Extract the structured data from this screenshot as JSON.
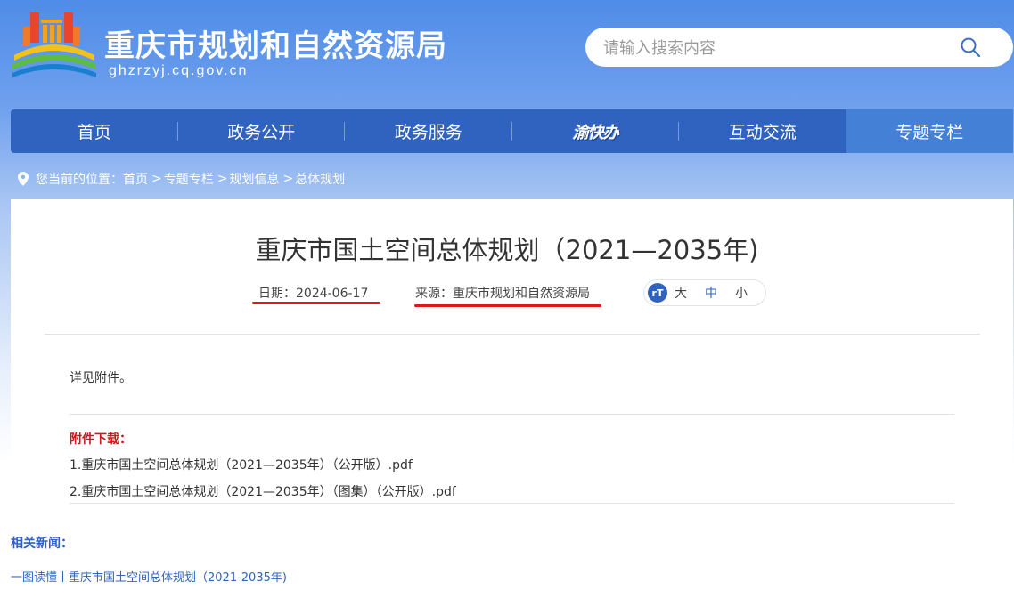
{
  "header": {
    "site_title": "重庆市规划和自然资源局",
    "site_domain": "ghzrzyj.cq.gov.cn",
    "search_placeholder": "请输入搜索内容"
  },
  "nav": {
    "items": [
      {
        "label": "首页"
      },
      {
        "label": "政务公开"
      },
      {
        "label": "政务服务"
      },
      {
        "label": "渝快办"
      },
      {
        "label": "互动交流"
      },
      {
        "label": "专题专栏",
        "active": true
      }
    ]
  },
  "breadcrumb": {
    "prefix": "您当前的位置：",
    "items": [
      "首页",
      "专题专栏",
      "规划信息",
      "总体规划"
    ],
    "separator": ">"
  },
  "article": {
    "title": "重庆市国土空间总体规划（2021—2035年)",
    "date": "日期：2024-06-17",
    "source": "来源：重庆市规划和自然资源局",
    "font_icon": "rT",
    "font_sizes": [
      "大",
      "中",
      "小"
    ],
    "font_size_selected": "中",
    "body": "详见附件。",
    "attachments_label": "附件下载：",
    "attachments": [
      "1.重庆市国土空间总体规划（2021—2035年）（公开版）.pdf",
      "2.重庆市国土空间总体规划（2021—2035年）（图集）（公开版）.pdf"
    ]
  },
  "related": {
    "label": "相关新闻：",
    "items": [
      "一图读懂丨重庆市国土空间总体规划（2021-2035年)"
    ]
  },
  "colors": {
    "nav_bg": "#2f63bf",
    "nav_active": "#4481d6",
    "highlight_underline": "#e01717",
    "attachment_label": "#d0151d",
    "link_blue": "#2f63bf"
  }
}
